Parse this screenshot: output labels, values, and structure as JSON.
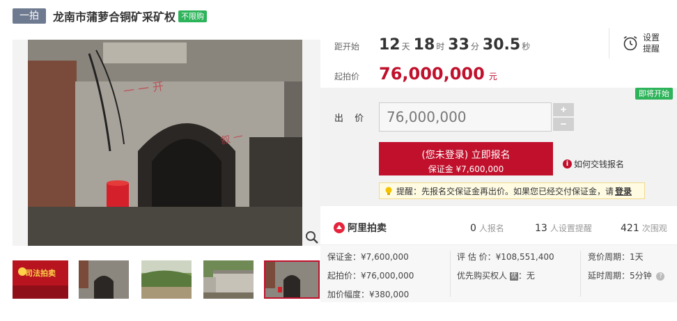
{
  "header": {
    "round_tag": "一拍",
    "title": "龙南市蒲萝合铜矿采矿权",
    "unlimited_tag": "不限购"
  },
  "gallery": {
    "thumbs": [
      {
        "label": "司法拍卖",
        "selected": false
      },
      {
        "label": "",
        "selected": false
      },
      {
        "label": "",
        "selected": false
      },
      {
        "label": "",
        "selected": false
      },
      {
        "label": "",
        "selected": true
      }
    ]
  },
  "countdown": {
    "label": "距开始",
    "days": "12",
    "days_unit": "天",
    "hours": "18",
    "hours_unit": "时",
    "minutes": "33",
    "minutes_unit": "分",
    "seconds": "30.5",
    "seconds_unit": "秒"
  },
  "remind": {
    "line1": "设置",
    "line2": "提醒"
  },
  "start_price": {
    "label": "起拍价",
    "value": "76,000,000",
    "unit": "元"
  },
  "bid": {
    "status_badge": "即将开始",
    "label": "出 价",
    "input_value": "76,000,000",
    "plus": "+",
    "minus": "−",
    "signup_main": "(您未登录) 立即报名",
    "signup_sub": "保证金 ¥7,600,000",
    "howto_icon": "i",
    "howto": "如何交钱报名",
    "tip_text": "提醒：先报名交保证金再出价。如果您已经交付保证金，请",
    "tip_link": "登录"
  },
  "stats": {
    "brand": "阿里拍卖",
    "signup_count": "0",
    "signup_label": "人报名",
    "remind_count": "13",
    "remind_label": "人设置提醒",
    "view_count": "421",
    "view_label": "次围观"
  },
  "info": {
    "deposit": "保证金：¥7,600,000",
    "start_price": "起拍价：¥76,000,000",
    "increment": "加价幅度：¥380,000",
    "appraisal": "评 估 价：¥108,551,400",
    "priority_label": "优先购买权人",
    "priority_icon": "优",
    "priority_value": "：无",
    "bid_period": "竞价周期：1天",
    "delay_period": "延时周期：5分钟",
    "help_icon": "?"
  },
  "colors": {
    "accent_red": "#c0102c",
    "green": "#2db35a",
    "tag_gray": "#6e7a90"
  }
}
